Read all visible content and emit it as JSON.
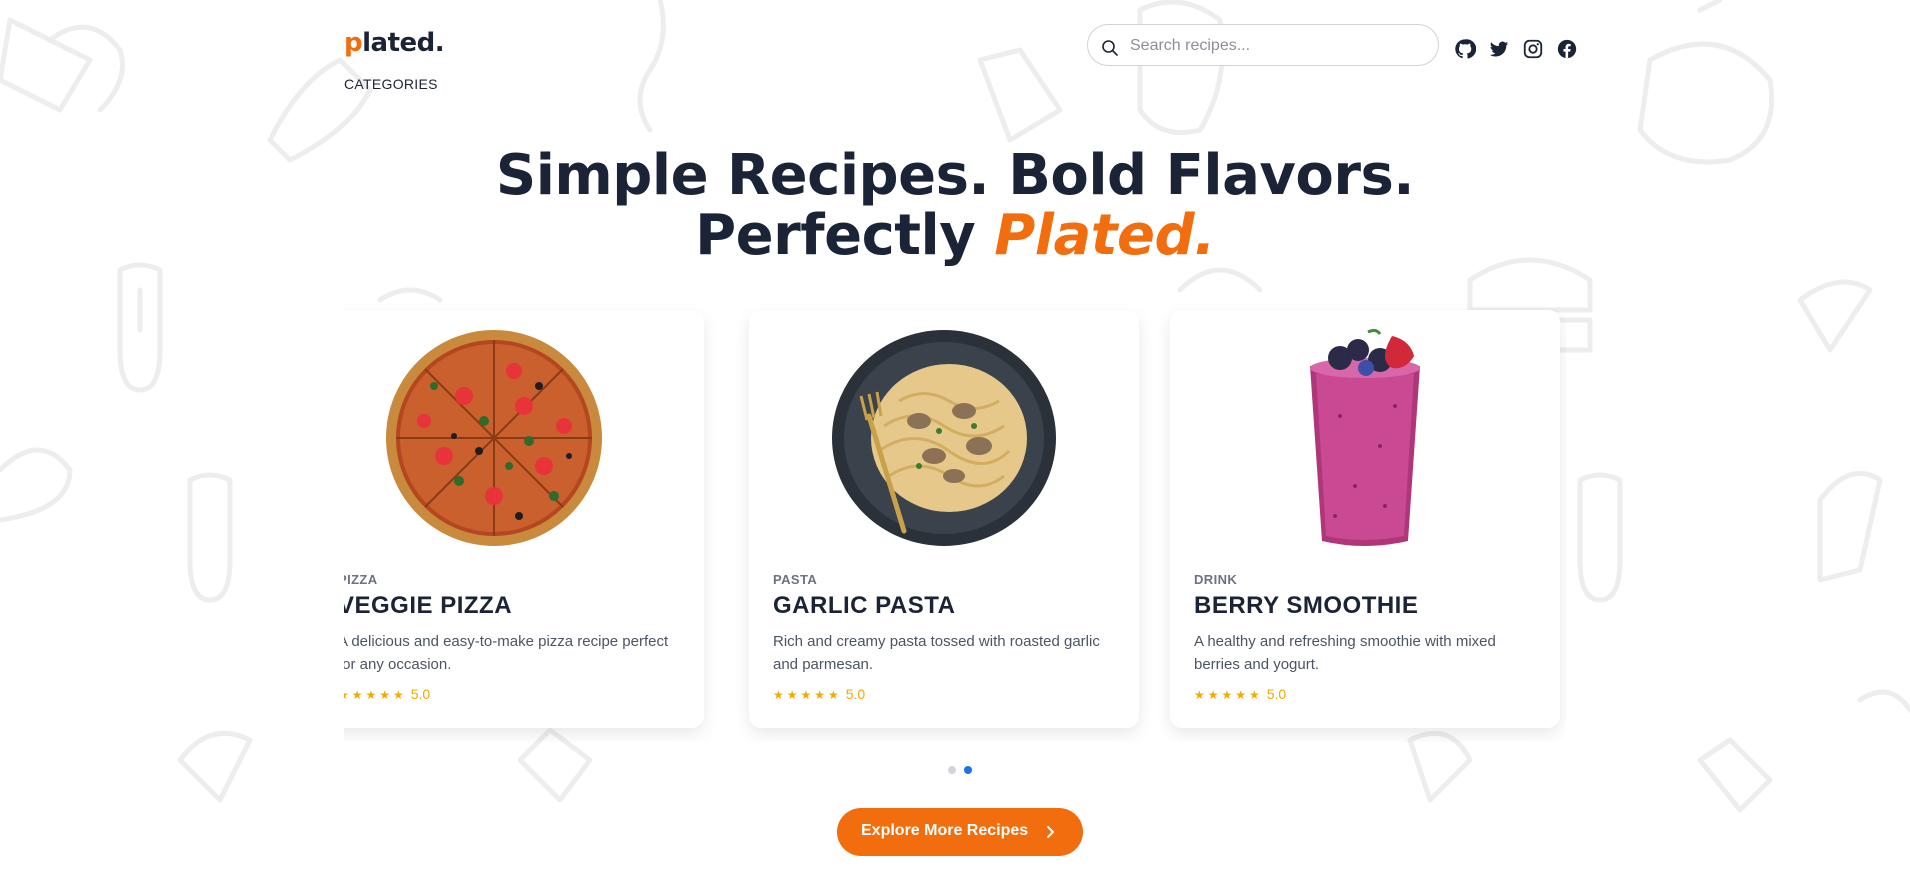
{
  "header": {
    "logo_accent": "p",
    "logo_rest": "lated.",
    "nav_categories": "CATEGORIES",
    "search_placeholder": "Search recipes...",
    "social_icons": [
      "github-icon",
      "twitter-icon",
      "instagram-icon",
      "facebook-icon"
    ]
  },
  "hero": {
    "line1": "Simple Recipes. Bold Flavors.",
    "line2_plain": "Perfectly ",
    "line2_accent": "Plated."
  },
  "recipes": [
    {
      "category": "PIZZA",
      "name": "VEGGIE PIZZA",
      "description": "A delicious and easy-to-make pizza recipe perfect for any occasion.",
      "stars": "★★★★★",
      "rating": "5.0"
    },
    {
      "category": "PASTA",
      "name": "GARLIC PASTA",
      "description": "Rich and creamy pasta tossed with roasted garlic and parmesan.",
      "stars": "★★★★★",
      "rating": "5.0"
    },
    {
      "category": "DRINK",
      "name": "BERRY SMOOTHIE",
      "description": "A healthy and refreshing smoothie with mixed berries and yogurt.",
      "stars": "★★★★★",
      "rating": "5.0"
    }
  ],
  "carousel": {
    "pages": 2,
    "active_page": 2
  },
  "cta": {
    "label": "Explore More Recipes"
  },
  "colors": {
    "accent": "#f26d0d",
    "text_dark": "#1b2436",
    "star": "#f2a900",
    "dot_active": "#1a73e8",
    "dot_inactive": "#d1d5db"
  }
}
